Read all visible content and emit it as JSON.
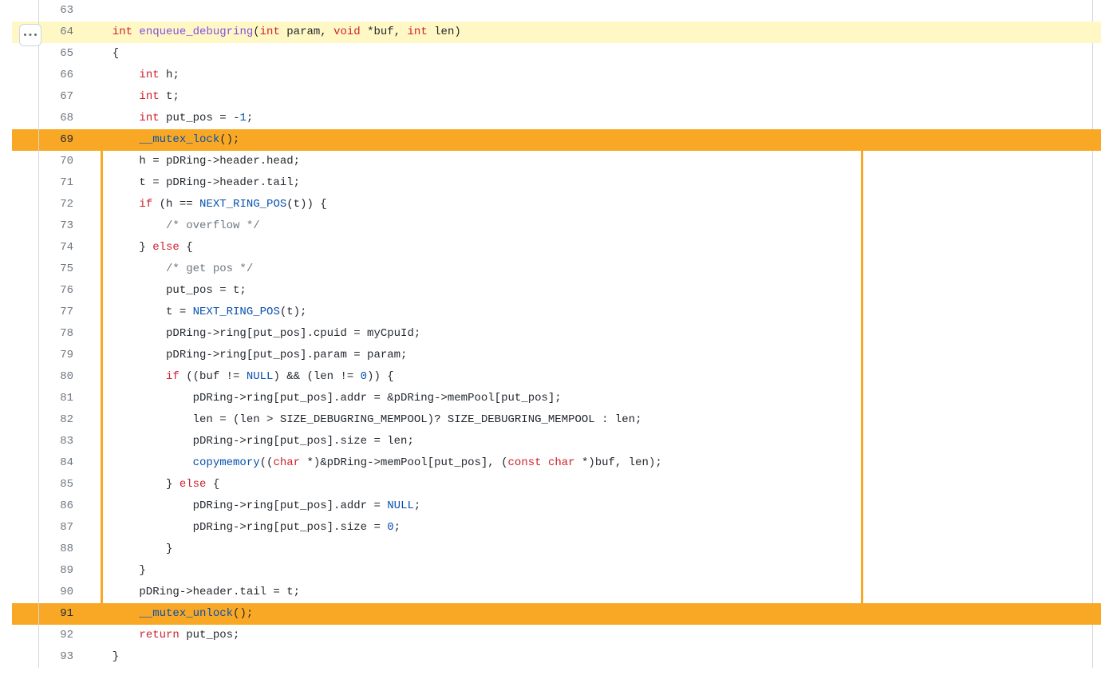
{
  "lines": [
    {
      "num": 63,
      "style": "",
      "tokens": []
    },
    {
      "num": 64,
      "style": "hl",
      "tokens": [
        {
          "c": "kw",
          "t": "  int"
        },
        {
          "c": "op",
          "t": " "
        },
        {
          "c": "fn",
          "t": "enqueue_debugring"
        },
        {
          "c": "op",
          "t": "("
        },
        {
          "c": "kw",
          "t": "int"
        },
        {
          "c": "op",
          "t": " param, "
        },
        {
          "c": "kw",
          "t": "void"
        },
        {
          "c": "op",
          "t": " *buf, "
        },
        {
          "c": "kw",
          "t": "int"
        },
        {
          "c": "op",
          "t": " len)"
        }
      ]
    },
    {
      "num": 65,
      "style": "",
      "tokens": [
        {
          "c": "op",
          "t": "  {"
        }
      ]
    },
    {
      "num": 66,
      "style": "",
      "tokens": [
        {
          "c": "op",
          "t": "      "
        },
        {
          "c": "kw",
          "t": "int"
        },
        {
          "c": "op",
          "t": " h;"
        }
      ]
    },
    {
      "num": 67,
      "style": "",
      "tokens": [
        {
          "c": "op",
          "t": "      "
        },
        {
          "c": "kw",
          "t": "int"
        },
        {
          "c": "op",
          "t": " t;"
        }
      ]
    },
    {
      "num": 68,
      "style": "",
      "tokens": [
        {
          "c": "op",
          "t": "      "
        },
        {
          "c": "kw",
          "t": "int"
        },
        {
          "c": "op",
          "t": " put_pos = "
        },
        {
          "c": "op",
          "t": "-"
        },
        {
          "c": "num",
          "t": "1"
        },
        {
          "c": "op",
          "t": ";"
        }
      ]
    },
    {
      "num": 69,
      "style": "hl-strong",
      "tokens": [
        {
          "c": "op",
          "t": "      "
        },
        {
          "c": "call",
          "t": "__mutex_lock"
        },
        {
          "c": "op",
          "t": "();"
        }
      ]
    },
    {
      "num": 70,
      "style": "boxed",
      "tokens": [
        {
          "c": "op",
          "t": "      h = pDRing->header.head;"
        }
      ]
    },
    {
      "num": 71,
      "style": "boxed",
      "tokens": [
        {
          "c": "op",
          "t": "      t = pDRing->header.tail;"
        }
      ]
    },
    {
      "num": 72,
      "style": "boxed",
      "tokens": [
        {
          "c": "op",
          "t": "      "
        },
        {
          "c": "kw",
          "t": "if"
        },
        {
          "c": "op",
          "t": " (h == "
        },
        {
          "c": "call",
          "t": "NEXT_RING_POS"
        },
        {
          "c": "op",
          "t": "(t)) {"
        }
      ]
    },
    {
      "num": 73,
      "style": "boxed",
      "tokens": [
        {
          "c": "op",
          "t": "          "
        },
        {
          "c": "cm",
          "t": "/* overflow */"
        }
      ]
    },
    {
      "num": 74,
      "style": "boxed",
      "tokens": [
        {
          "c": "op",
          "t": "      } "
        },
        {
          "c": "kw",
          "t": "else"
        },
        {
          "c": "op",
          "t": " {"
        }
      ]
    },
    {
      "num": 75,
      "style": "boxed",
      "tokens": [
        {
          "c": "op",
          "t": "          "
        },
        {
          "c": "cm",
          "t": "/* get pos */"
        }
      ]
    },
    {
      "num": 76,
      "style": "boxed",
      "tokens": [
        {
          "c": "op",
          "t": "          put_pos = t;"
        }
      ]
    },
    {
      "num": 77,
      "style": "boxed",
      "tokens": [
        {
          "c": "op",
          "t": "          t = "
        },
        {
          "c": "call",
          "t": "NEXT_RING_POS"
        },
        {
          "c": "op",
          "t": "(t);"
        }
      ]
    },
    {
      "num": 78,
      "style": "boxed",
      "tokens": [
        {
          "c": "op",
          "t": "          pDRing->ring[put_pos].cpuid = myCpuId;"
        }
      ]
    },
    {
      "num": 79,
      "style": "boxed",
      "tokens": [
        {
          "c": "op",
          "t": "          pDRing->ring[put_pos].param = param;"
        }
      ]
    },
    {
      "num": 80,
      "style": "boxed",
      "tokens": [
        {
          "c": "op",
          "t": "          "
        },
        {
          "c": "kw",
          "t": "if"
        },
        {
          "c": "op",
          "t": " ((buf != "
        },
        {
          "c": "call",
          "t": "NULL"
        },
        {
          "c": "op",
          "t": ") && (len != "
        },
        {
          "c": "num",
          "t": "0"
        },
        {
          "c": "op",
          "t": ")) {"
        }
      ]
    },
    {
      "num": 81,
      "style": "boxed",
      "tokens": [
        {
          "c": "op",
          "t": "              pDRing->ring[put_pos].addr = &pDRing->memPool[put_pos];"
        }
      ]
    },
    {
      "num": 82,
      "style": "boxed",
      "tokens": [
        {
          "c": "op",
          "t": "              len = (len > SIZE_DEBUGRING_MEMPOOL)? SIZE_DEBUGRING_MEMPOOL : len;"
        }
      ]
    },
    {
      "num": 83,
      "style": "boxed",
      "tokens": [
        {
          "c": "op",
          "t": "              pDRing->ring[put_pos].size = len;"
        }
      ]
    },
    {
      "num": 84,
      "style": "boxed",
      "tokens": [
        {
          "c": "op",
          "t": "              "
        },
        {
          "c": "call",
          "t": "copymemory"
        },
        {
          "c": "op",
          "t": "(("
        },
        {
          "c": "kw",
          "t": "char"
        },
        {
          "c": "op",
          "t": " *)&pDRing->memPool[put_pos], ("
        },
        {
          "c": "kw",
          "t": "const"
        },
        {
          "c": "op",
          "t": " "
        },
        {
          "c": "kw",
          "t": "char"
        },
        {
          "c": "op",
          "t": " *)buf, len);"
        }
      ]
    },
    {
      "num": 85,
      "style": "boxed",
      "tokens": [
        {
          "c": "op",
          "t": "          } "
        },
        {
          "c": "kw",
          "t": "else"
        },
        {
          "c": "op",
          "t": " {"
        }
      ]
    },
    {
      "num": 86,
      "style": "boxed",
      "tokens": [
        {
          "c": "op",
          "t": "              pDRing->ring[put_pos].addr = "
        },
        {
          "c": "call",
          "t": "NULL"
        },
        {
          "c": "op",
          "t": ";"
        }
      ]
    },
    {
      "num": 87,
      "style": "boxed",
      "tokens": [
        {
          "c": "op",
          "t": "              pDRing->ring[put_pos].size = "
        },
        {
          "c": "num",
          "t": "0"
        },
        {
          "c": "op",
          "t": ";"
        }
      ]
    },
    {
      "num": 88,
      "style": "boxed",
      "tokens": [
        {
          "c": "op",
          "t": "          }"
        }
      ]
    },
    {
      "num": 89,
      "style": "boxed",
      "tokens": [
        {
          "c": "op",
          "t": "      }"
        }
      ]
    },
    {
      "num": 90,
      "style": "boxed",
      "tokens": [
        {
          "c": "op",
          "t": "      pDRing->header.tail = t;"
        }
      ]
    },
    {
      "num": 91,
      "style": "hl-strong",
      "tokens": [
        {
          "c": "op",
          "t": "      "
        },
        {
          "c": "call",
          "t": "__mutex_unlock"
        },
        {
          "c": "op",
          "t": "();"
        }
      ]
    },
    {
      "num": 92,
      "style": "",
      "tokens": [
        {
          "c": "op",
          "t": "      "
        },
        {
          "c": "kw",
          "t": "return"
        },
        {
          "c": "op",
          "t": " put_pos;"
        }
      ]
    },
    {
      "num": 93,
      "style": "",
      "tokens": [
        {
          "c": "op",
          "t": "  }"
        }
      ]
    }
  ],
  "icons": {
    "more": "kebab-horizontal-icon"
  }
}
